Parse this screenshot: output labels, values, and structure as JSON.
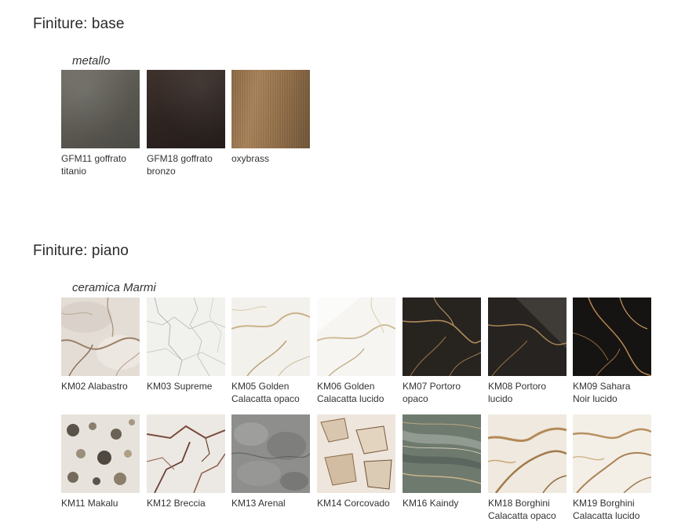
{
  "sections": [
    {
      "title": "Finiture: base",
      "groups": [
        {
          "subtitle": "metallo",
          "items": [
            {
              "label": "GFM11 goffrato\ntitanio",
              "icon": "titanio-swatch"
            },
            {
              "label": "GFM18 goffrato\nbronzo",
              "icon": "bronzo-swatch"
            },
            {
              "label": "oxybrass",
              "icon": "oxybrass-swatch"
            }
          ]
        }
      ]
    },
    {
      "title": "Finiture: piano",
      "groups": [
        {
          "subtitle": "ceramica Marmi",
          "items": [
            {
              "label": "KM02 Alabastro"
            },
            {
              "label": "KM03 Supreme"
            },
            {
              "label": "KM05 Golden\nCalacatta opaco"
            },
            {
              "label": "KM06 Golden\nCalacatta lucido"
            },
            {
              "label": "KM07 Portoro\nopaco"
            },
            {
              "label": "KM08 Portoro\nlucido"
            },
            {
              "label": "KM09 Sahara\nNoir lucido"
            },
            {
              "label": "KM11 Makalu"
            },
            {
              "label": "KM12 Breccia"
            },
            {
              "label": "KM13 Arenal"
            },
            {
              "label": "KM14 Corcovado"
            },
            {
              "label": "KM16 Kaindy"
            },
            {
              "label": "KM18 Borghini\nCalacatta opaco"
            },
            {
              "label": "KM19 Borghini\nCalacatta lucido"
            }
          ]
        }
      ]
    }
  ],
  "colors": {
    "text": "#2a2a2a",
    "background": "#ffffff"
  }
}
